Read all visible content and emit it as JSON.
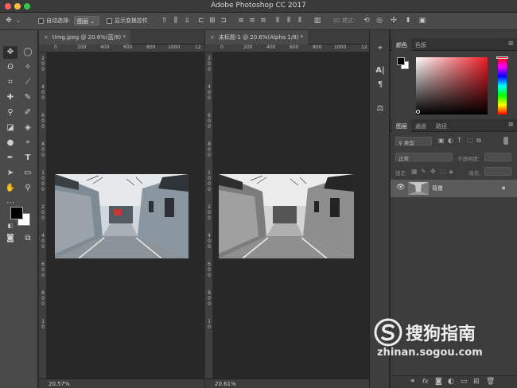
{
  "window": {
    "title": "Adobe Photoshop CC 2017"
  },
  "options_bar": {
    "auto_select_label": "自动选择:",
    "auto_select_value": "图层",
    "show_transform_label": "显示变换控件",
    "mode_3d_label": "3D 模式:"
  },
  "documents": [
    {
      "tab_label": "timg.jpeg @ 20.6%(蓝/8) *",
      "zoom": "20.57%",
      "ruler_h": [
        "0",
        "200",
        "400",
        "600",
        "800",
        "1000",
        "12"
      ],
      "ruler_v": [
        "2",
        "0",
        "0",
        "4",
        "0",
        "0",
        "6",
        "0",
        "0",
        "8",
        "0",
        "0",
        "1",
        "0",
        "0",
        "0",
        "2",
        "0",
        "0",
        "4",
        "0",
        "0",
        "6",
        "0",
        "0",
        "8",
        "0",
        "0",
        "1",
        "0"
      ]
    },
    {
      "tab_label": "未标题-1 @ 20.6%(Alpha 1/8) *",
      "zoom": "20.61%",
      "ruler_h": [
        "0",
        "200",
        "400",
        "600",
        "800",
        "1000",
        "12"
      ],
      "ruler_v": [
        "2",
        "0",
        "0",
        "4",
        "0",
        "0",
        "6",
        "0",
        "0",
        "8",
        "0",
        "0",
        "1",
        "0",
        "0",
        "0",
        "2",
        "0",
        "0",
        "4",
        "0",
        "0",
        "6",
        "0",
        "0",
        "8",
        "0",
        "0",
        "1",
        "0"
      ]
    }
  ],
  "color_panel": {
    "tabs": [
      "颜色",
      "色板"
    ]
  },
  "layers_panel": {
    "tabs": [
      "图层",
      "通道",
      "路径"
    ],
    "filter_label": "类型",
    "blend_mode": "正常",
    "opacity_label": "不透明度:",
    "lock_label": "锁定:",
    "fill_label": "填充:",
    "layers": [
      {
        "name": "背景",
        "visible": true,
        "locked": true
      }
    ]
  },
  "watermark": {
    "brand": "搜狗指南",
    "url": "zhinan.sogou.com"
  },
  "colors": {
    "accent": "#ed1c24",
    "foreground": "#000000",
    "background": "#ffffff"
  }
}
